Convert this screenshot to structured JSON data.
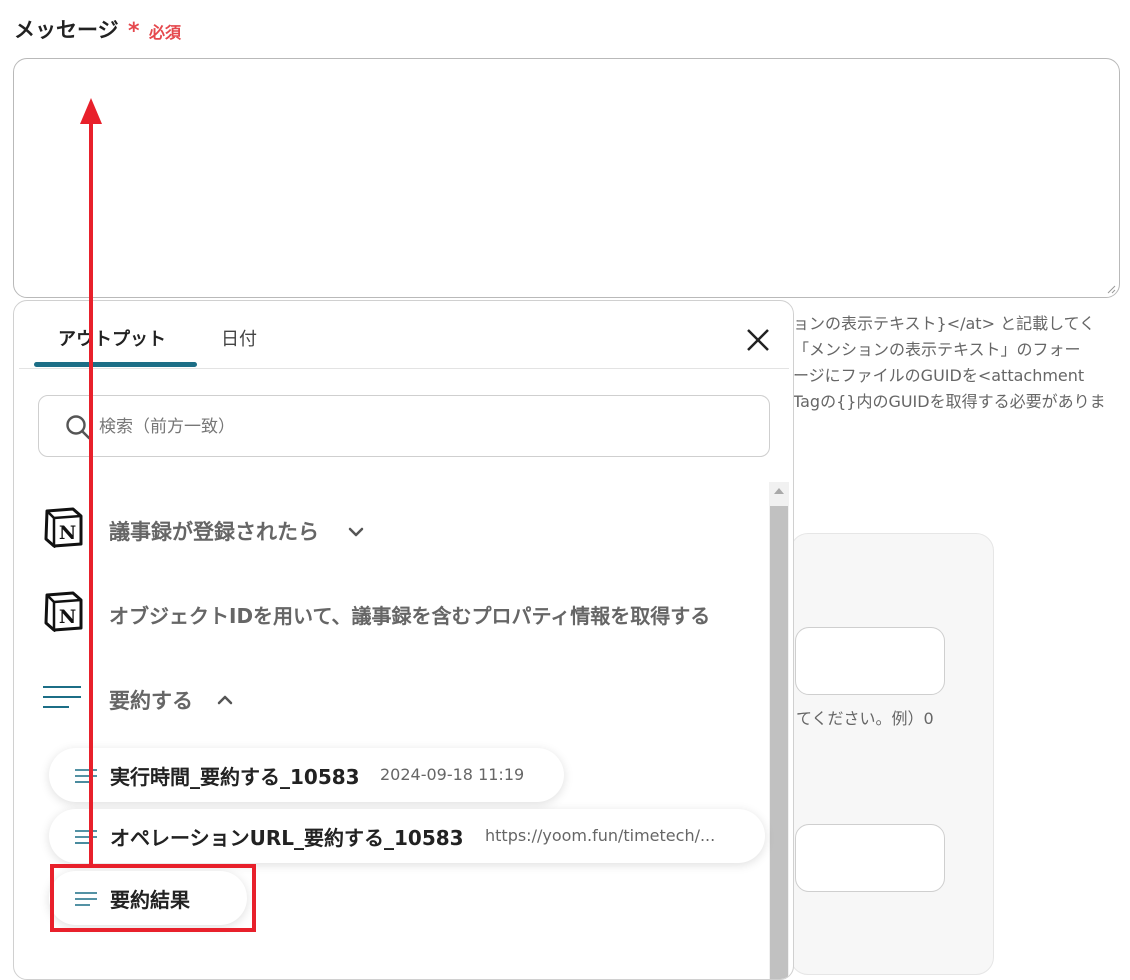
{
  "field": {
    "label": "メッセージ",
    "required_mark": "*",
    "required_text": "必須"
  },
  "help_lines": [
    "ョンの表示テキスト}</at> と記載してく",
    "「メンションの表示テキスト」のフォー",
    "ージにファイルのGUIDを<attachment",
    "Tagの{}内のGUIDを取得する必要がありま"
  ],
  "bg_note": "てください。例）0",
  "popup": {
    "tabs": [
      {
        "label": "アウトプット",
        "active": true
      },
      {
        "label": "日付",
        "active": false
      }
    ],
    "search": {
      "placeholder": "検索（前方一致）",
      "value": ""
    },
    "sections": [
      {
        "icon": "notion-icon",
        "title": "議事録が登録されたら",
        "expanded": false
      },
      {
        "icon": "notion-icon",
        "title": "オブジェクトIDを用いて、議事録を含むプロパティ情報を取得する"
      },
      {
        "icon": "lines-icon",
        "title": "要約する",
        "expanded": true
      }
    ],
    "chips": [
      {
        "label": "実行時間_要約する_10583",
        "value": "2024-09-18 11:19"
      },
      {
        "label": "オペレーションURL_要約する_10583",
        "value": "https://yoom.fun/timetech/..."
      },
      {
        "label": "要約結果",
        "value": ""
      }
    ]
  },
  "colors": {
    "accent": "#1c6e86",
    "required": "#e5484d",
    "annotation": "#e8202b"
  }
}
